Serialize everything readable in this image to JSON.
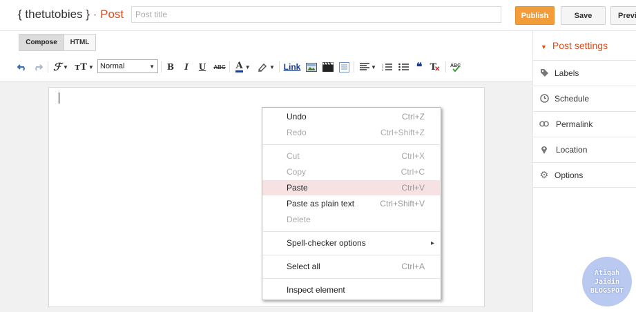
{
  "header": {
    "blog_title": "{ thetutobies }",
    "separator": "·",
    "section": "Post",
    "post_title_placeholder": "Post title",
    "publish_label": "Publish",
    "save_label": "Save",
    "preview_label": "Previ"
  },
  "editor": {
    "mode_tabs": [
      "Compose",
      "HTML"
    ],
    "active_mode": "Compose",
    "format_select": "Normal",
    "toolbar": {
      "undo": "undo-icon",
      "redo": "redo-icon",
      "font": "font-icon",
      "font_size": "font-size-icon",
      "bold": "B",
      "italic": "I",
      "underline": "U",
      "strike": "ABC",
      "text_color": "A",
      "highlight": "highlighter-icon",
      "link": "Link",
      "image": "image-icon",
      "video": "video-icon",
      "jump_break": "jump-break-icon",
      "align": "align-icon",
      "numbered_list": "numbered-list-icon",
      "bulleted_list": "bulleted-list-icon",
      "quote": "❝",
      "remove_format": "T",
      "spellcheck": "spellcheck-icon"
    }
  },
  "context_menu": {
    "items": [
      {
        "label": "Undo",
        "shortcut": "Ctrl+Z",
        "enabled": true
      },
      {
        "label": "Redo",
        "shortcut": "Ctrl+Shift+Z",
        "enabled": false
      },
      {
        "label": "Cut",
        "shortcut": "Ctrl+X",
        "enabled": false
      },
      {
        "label": "Copy",
        "shortcut": "Ctrl+C",
        "enabled": false
      },
      {
        "label": "Paste",
        "shortcut": "Ctrl+V",
        "enabled": true,
        "highlighted": true
      },
      {
        "label": "Paste as plain text",
        "shortcut": "Ctrl+Shift+V",
        "enabled": true
      },
      {
        "label": "Delete",
        "shortcut": "",
        "enabled": false
      },
      {
        "label": "Spell-checker options",
        "shortcut": "",
        "enabled": true,
        "submenu": true
      },
      {
        "label": "Select all",
        "shortcut": "Ctrl+A",
        "enabled": true
      },
      {
        "label": "Inspect element",
        "shortcut": "",
        "enabled": true
      }
    ],
    "submenu_arrow": "▸"
  },
  "sidebar": {
    "header": "Post settings",
    "items": [
      {
        "label": "Labels",
        "icon": "tag-icon"
      },
      {
        "label": "Schedule",
        "icon": "clock-icon"
      },
      {
        "label": "Permalink",
        "icon": "link-icon"
      },
      {
        "label": "Location",
        "icon": "pin-icon"
      },
      {
        "label": "Options",
        "icon": "gear-icon"
      }
    ]
  },
  "watermark": {
    "lines": [
      "Atiqah",
      "Jaidin",
      "BLOGSPOT"
    ]
  },
  "colors": {
    "accent_orange": "#dd4b1d",
    "publish_bg": "#f39c3a",
    "menu_highlight": "#f6e2e2",
    "badge_bg": "#b9c9ef"
  }
}
